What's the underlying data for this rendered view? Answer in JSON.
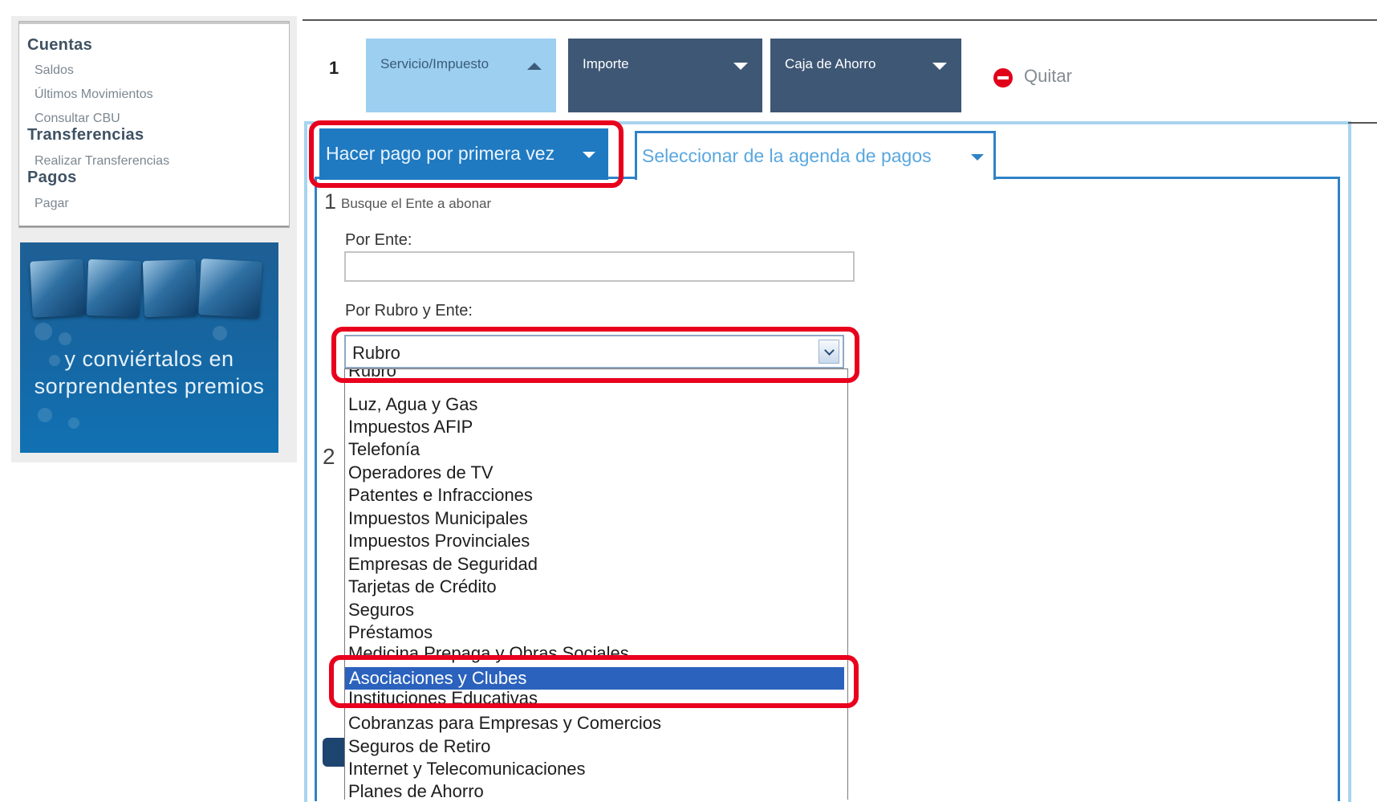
{
  "sidebar": {
    "sections": [
      {
        "title": "Cuentas",
        "links": [
          "Saldos",
          "Últimos Movimientos",
          "Consultar CBU"
        ]
      },
      {
        "title": "Transferencias",
        "links": [
          "Realizar Transferencias"
        ]
      },
      {
        "title": "Pagos",
        "links": [
          "Pagar"
        ]
      }
    ],
    "promo_text_line1": "y conviértalos en",
    "promo_text_line2": "sorprendentes premios"
  },
  "steps_bar": {
    "step_number": "1",
    "tabs": [
      "Servicio/Impuesto",
      "Importe",
      "Caja de Ahorro"
    ],
    "remove_label": "Quitar"
  },
  "payment_options": {
    "primary_tab": "Hacer pago por primera vez",
    "secondary_tab": "Seleccionar de la agenda de pagos"
  },
  "form": {
    "step1_number": "1",
    "step1_text": "Busque el Ente a abonar",
    "por_ente_label": "Por Ente:",
    "por_ente_value": "",
    "por_rubro_label": "Por Rubro y Ente:",
    "rubro_selected": "Rubro",
    "step2_number": "2"
  },
  "dropdown": {
    "items": [
      "Rubro",
      "Luz, Agua y Gas",
      "Impuestos AFIP",
      "Telefonía",
      "Operadores de TV",
      "Patentes e Infracciones",
      "Impuestos Municipales",
      "Impuestos Provinciales",
      "Empresas de Seguridad",
      "Tarjetas de Crédito",
      "Seguros",
      "Préstamos",
      "Medicina Prepaga y Obras Sociales",
      "Asociaciones y Clubes",
      "Instituciones Educativas",
      "Cobranzas para Empresas y Comercios",
      "Seguros de Retiro",
      "Internet y Telecomunicaciones",
      "Planes de Ahorro"
    ],
    "selected": "Asociaciones y Clubes"
  },
  "colors": {
    "highlight_red": "#e8001d",
    "primary_blue": "#1f7ac1",
    "selected_item": "#2b62bd",
    "tab_dark": "#3e5775",
    "tab_active": "#9ccff0"
  }
}
